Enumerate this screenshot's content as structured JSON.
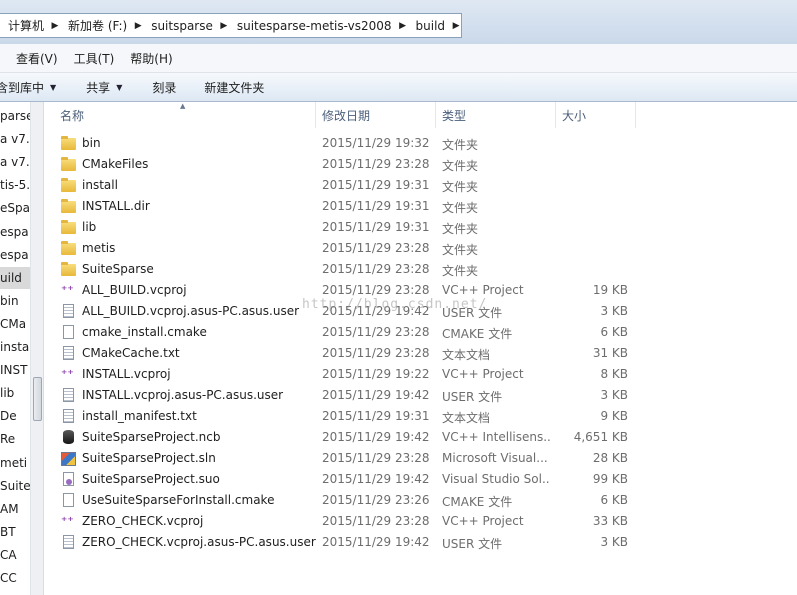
{
  "breadcrumb": {
    "items": [
      "计算机",
      "新加卷 (F:)",
      "suitsparse",
      "suitesparse-metis-vs2008",
      "build"
    ]
  },
  "menu": {
    "items": [
      "查看(V)",
      "工具(T)",
      "帮助(H)"
    ]
  },
  "toolbar": {
    "include_label": "含到库中",
    "share_label": "共享",
    "burn_label": "刻录",
    "new_folder_label": "新建文件夹"
  },
  "navpane": {
    "items": [
      "parse",
      "a v7.",
      "a v7.",
      "tis-5.",
      "eSpa",
      "espa",
      "espa",
      "uild",
      "bin",
      "CMa",
      "insta",
      "INST",
      "lib",
      "De",
      "Re",
      "meti",
      "Suite",
      "AM",
      "BT",
      "CA",
      "CC"
    ],
    "selected_index": 7
  },
  "columns": {
    "name": "名称",
    "date": "修改日期",
    "type": "类型",
    "size": "大小"
  },
  "files": [
    {
      "name": "bin",
      "date": "2015/11/29 19:32",
      "type": "文件夹",
      "size": "",
      "icon": "folder-icon"
    },
    {
      "name": "CMakeFiles",
      "date": "2015/11/29 23:28",
      "type": "文件夹",
      "size": "",
      "icon": "folder-icon"
    },
    {
      "name": "install",
      "date": "2015/11/29 19:31",
      "type": "文件夹",
      "size": "",
      "icon": "folder-icon"
    },
    {
      "name": "INSTALL.dir",
      "date": "2015/11/29 19:31",
      "type": "文件夹",
      "size": "",
      "icon": "folder-icon"
    },
    {
      "name": "lib",
      "date": "2015/11/29 19:31",
      "type": "文件夹",
      "size": "",
      "icon": "folder-icon"
    },
    {
      "name": "metis",
      "date": "2015/11/29 23:28",
      "type": "文件夹",
      "size": "",
      "icon": "folder-icon"
    },
    {
      "name": "SuiteSparse",
      "date": "2015/11/29 23:28",
      "type": "文件夹",
      "size": "",
      "icon": "folder-icon"
    },
    {
      "name": "ALL_BUILD.vcproj",
      "date": "2015/11/29 23:28",
      "type": "VC++ Project",
      "size": "19 KB",
      "icon": "vcproj-icon"
    },
    {
      "name": "ALL_BUILD.vcproj.asus-PC.asus.user",
      "date": "2015/11/29 19:42",
      "type": "USER 文件",
      "size": "3 KB",
      "icon": "text-file-icon"
    },
    {
      "name": "cmake_install.cmake",
      "date": "2015/11/29 23:28",
      "type": "CMAKE 文件",
      "size": "6 KB",
      "icon": "blank-file-icon"
    },
    {
      "name": "CMakeCache.txt",
      "date": "2015/11/29 23:28",
      "type": "文本文档",
      "size": "31 KB",
      "icon": "text-file-icon"
    },
    {
      "name": "INSTALL.vcproj",
      "date": "2015/11/29 19:22",
      "type": "VC++ Project",
      "size": "8 KB",
      "icon": "vcproj-icon"
    },
    {
      "name": "INSTALL.vcproj.asus-PC.asus.user",
      "date": "2015/11/29 19:42",
      "type": "USER 文件",
      "size": "3 KB",
      "icon": "text-file-icon"
    },
    {
      "name": "install_manifest.txt",
      "date": "2015/11/29 19:31",
      "type": "文本文档",
      "size": "9 KB",
      "icon": "text-file-icon"
    },
    {
      "name": "SuiteSparseProject.ncb",
      "date": "2015/11/29 19:42",
      "type": "VC++ Intellisens...",
      "size": "4,651 KB",
      "icon": "database-icon"
    },
    {
      "name": "SuiteSparseProject.sln",
      "date": "2015/11/29 23:28",
      "type": "Microsoft Visual...",
      "size": "28 KB",
      "icon": "solution-icon"
    },
    {
      "name": "SuiteSparseProject.suo",
      "date": "2015/11/29 19:42",
      "type": "Visual Studio Sol...",
      "size": "99 KB",
      "icon": "suo-file-icon"
    },
    {
      "name": "UseSuiteSparseForInstall.cmake",
      "date": "2015/11/29 23:26",
      "type": "CMAKE 文件",
      "size": "6 KB",
      "icon": "blank-file-icon"
    },
    {
      "name": "ZERO_CHECK.vcproj",
      "date": "2015/11/29 23:28",
      "type": "VC++ Project",
      "size": "33 KB",
      "icon": "vcproj-icon"
    },
    {
      "name": "ZERO_CHECK.vcproj.asus-PC.asus.user",
      "date": "2015/11/29 19:42",
      "type": "USER 文件",
      "size": "3 KB",
      "icon": "text-file-icon"
    }
  ],
  "watermark": "http://blog.csdn.net/",
  "colors": {
    "folder": "#e8b83a",
    "header_text": "#4c607a",
    "meta_text": "#6d6d6d"
  }
}
